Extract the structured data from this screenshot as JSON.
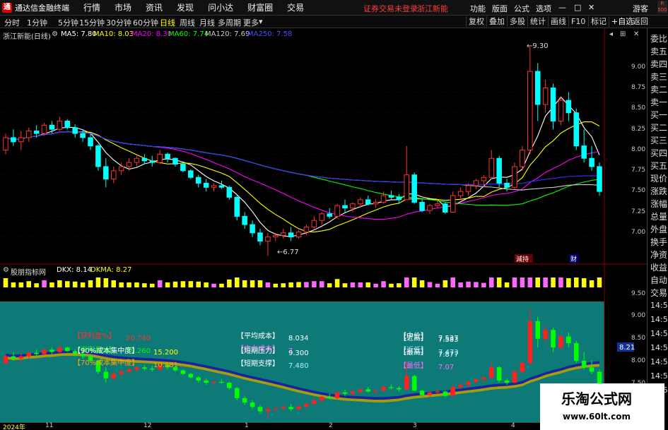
{
  "app": {
    "logo": "通",
    "title": "通达信金融终端"
  },
  "menus": [
    "行情",
    "市场",
    "资讯",
    "发现",
    "问小达",
    "财富圈",
    "交易"
  ],
  "warning": "证券交易未登录",
  "stock_name": "浙江新能",
  "right_menus": [
    "功能",
    "版面",
    "公式",
    "选项"
  ],
  "guest": "游客",
  "corner_badge": "R\n500",
  "timeframes": [
    "分时",
    "1分钟",
    "5分钟",
    "15分钟",
    "30分钟",
    "60分钟",
    "日线",
    "周线",
    "月线",
    "多周期",
    "更多"
  ],
  "active_timeframe": "日线",
  "toolbar_buttons": [
    "复权",
    "叠加",
    "多股",
    "统计",
    "画线",
    "F10",
    "标记",
    "+自选",
    "返回"
  ],
  "main_header": {
    "title": "浙江新能(日线)",
    "ma5": "MA5: 7.80",
    "ma10": "MA10: 8.03",
    "ma20": "MA20: 8.30",
    "ma60": "MA60: 7.74",
    "ma120": "MA120: 7.69",
    "ma250": "MA250: 7.58"
  },
  "annotations": {
    "high": "9.30",
    "low": "6.77",
    "event1": "減持",
    "event2": "财"
  },
  "y_ticks_main": [
    "9.00",
    "8.75",
    "8.50",
    "8.25",
    "8.00",
    "7.75",
    "7.50",
    "7.25",
    "7.00"
  ],
  "indicator_header": {
    "name": "股朋指标网",
    "dkx": "DKX: 8.14",
    "dkma": "DKMA: 8.27"
  },
  "y_ticks_ind": [
    "9.50"
  ],
  "y_ticks_teal": [
    "9.00",
    "8.50",
    "8.00",
    "7.50"
  ],
  "teal_current": "8.21",
  "teal": {
    "profit_label": "【获利盘%】",
    "profit_value": "20.740",
    "trapped_label": "【套牢盘%】",
    "trapped_value": "79.260",
    "c90_label": "【90%成本集中度】",
    "c90_value": "15.200",
    "c70_label": "【70%成本集中度】",
    "c70_value": "10.881",
    "avg_cost_label": "【平均成本】",
    "avg_cost_value": "8.034",
    "main_cost_label": "【主力成本】",
    "main_cost_value": "7",
    "press_label": "【短期压力】",
    "press_value": "9.300",
    "support_label": "【短期支撑】",
    "support_value": "7.480",
    "mid_label": "【中价】",
    "mid_value": "7.537",
    "recent_high_label": "【近高】",
    "recent_high_value": "7.583",
    "recent_low_label": "【近低】",
    "recent_low_value": "7.473",
    "top_label": "【最高】",
    "top_value": "7.877",
    "bottom_label": "【最低】",
    "bottom_value": "7.07"
  },
  "dates": [
    "2024年",
    "11",
    "12",
    "1",
    "2",
    "3",
    "4"
  ],
  "right_panel": [
    "委比",
    "卖五",
    "卖四",
    "卖三",
    "卖二",
    "卖一",
    "买一",
    "买二",
    "买三",
    "买四",
    "买五",
    "现价",
    "涨跌",
    "涨幅",
    "总量",
    "外盘",
    "换手",
    "净资",
    "收益",
    "自动",
    "交易"
  ],
  "time_ticks": [
    "14:56",
    "14:56",
    "14:56",
    "14:56",
    "14:56",
    "14:56",
    "14:56"
  ],
  "watermark": {
    "line1": "乐淘公式网",
    "line2": "www.60lt.com"
  },
  "chart_data": {
    "type": "candlestick",
    "ylim": [
      6.75,
      9.35
    ],
    "ohlc": [
      [
        8.05,
        8.25,
        8.0,
        8.2
      ],
      [
        8.2,
        8.3,
        8.1,
        8.15
      ],
      [
        8.15,
        8.28,
        8.05,
        8.2
      ],
      [
        8.2,
        8.32,
        8.15,
        8.28
      ],
      [
        8.28,
        8.35,
        8.2,
        8.25
      ],
      [
        8.25,
        8.38,
        8.22,
        8.35
      ],
      [
        8.35,
        8.4,
        8.25,
        8.3
      ],
      [
        8.3,
        8.45,
        8.28,
        8.4
      ],
      [
        8.4,
        8.42,
        8.3,
        8.32
      ],
      [
        8.32,
        8.36,
        8.2,
        8.25
      ],
      [
        8.25,
        8.3,
        8.15,
        8.2
      ],
      [
        8.2,
        8.25,
        8.05,
        8.1
      ],
      [
        8.1,
        8.12,
        7.8,
        7.85
      ],
      [
        7.85,
        7.95,
        7.6,
        7.7
      ],
      [
        7.7,
        7.85,
        7.65,
        7.8
      ],
      [
        7.8,
        7.9,
        7.75,
        7.85
      ],
      [
        7.85,
        7.95,
        7.8,
        7.9
      ],
      [
        7.9,
        7.98,
        7.85,
        7.95
      ],
      [
        7.95,
        8.0,
        7.88,
        7.92
      ],
      [
        7.92,
        7.98,
        7.85,
        7.9
      ],
      [
        7.9,
        8.05,
        7.88,
        8.0
      ],
      [
        8.0,
        8.02,
        7.9,
        7.95
      ],
      [
        7.95,
        7.96,
        7.85,
        7.88
      ],
      [
        7.88,
        7.9,
        7.78,
        7.8
      ],
      [
        7.8,
        7.82,
        7.7,
        7.72
      ],
      [
        7.72,
        7.75,
        7.6,
        7.65
      ],
      [
        7.65,
        7.7,
        7.55,
        7.6
      ],
      [
        7.6,
        7.65,
        7.55,
        7.62
      ],
      [
        7.62,
        7.68,
        7.58,
        7.6
      ],
      [
        7.6,
        7.62,
        7.45,
        7.48
      ],
      [
        7.48,
        7.5,
        7.2,
        7.25
      ],
      [
        7.25,
        7.3,
        7.1,
        7.15
      ],
      [
        7.15,
        7.2,
        7.0,
        7.05
      ],
      [
        7.05,
        7.1,
        6.9,
        6.95
      ],
      [
        6.95,
        7.05,
        6.77,
        7.0
      ],
      [
        7.0,
        7.05,
        6.95,
        7.02
      ],
      [
        7.02,
        7.1,
        6.98,
        7.05
      ],
      [
        7.05,
        7.12,
        6.95,
        7.0
      ],
      [
        7.0,
        7.08,
        6.98,
        7.06
      ],
      [
        7.06,
        7.15,
        7.02,
        7.12
      ],
      [
        7.12,
        7.25,
        7.1,
        7.2
      ],
      [
        7.2,
        7.3,
        7.15,
        7.28
      ],
      [
        7.28,
        7.35,
        7.22,
        7.25
      ],
      [
        7.25,
        7.4,
        7.22,
        7.38
      ],
      [
        7.38,
        7.45,
        7.3,
        7.35
      ],
      [
        7.35,
        7.42,
        7.3,
        7.4
      ],
      [
        7.4,
        7.48,
        7.35,
        7.45
      ],
      [
        7.45,
        7.5,
        7.38,
        7.4
      ],
      [
        7.4,
        7.46,
        7.35,
        7.42
      ],
      [
        7.42,
        7.55,
        7.4,
        7.5
      ],
      [
        7.5,
        7.56,
        7.45,
        7.48
      ],
      [
        7.48,
        7.52,
        7.4,
        7.45
      ],
      [
        7.45,
        8.1,
        7.45,
        7.75
      ],
      [
        7.75,
        7.78,
        7.4,
        7.42
      ],
      [
        7.42,
        7.45,
        7.3,
        7.32
      ],
      [
        7.32,
        7.4,
        7.28,
        7.38
      ],
      [
        7.38,
        7.45,
        7.35,
        7.4
      ],
      [
        7.4,
        7.42,
        7.28,
        7.3
      ],
      [
        7.3,
        7.55,
        7.3,
        7.5
      ],
      [
        7.5,
        7.6,
        7.45,
        7.55
      ],
      [
        7.55,
        7.65,
        7.5,
        7.62
      ],
      [
        7.62,
        7.7,
        7.58,
        7.68
      ],
      [
        7.68,
        7.75,
        7.6,
        7.72
      ],
      [
        7.72,
        8.05,
        7.7,
        7.95
      ],
      [
        7.95,
        7.98,
        7.6,
        7.65
      ],
      [
        7.65,
        7.7,
        7.55,
        7.6
      ],
      [
        7.6,
        7.9,
        7.58,
        7.85
      ],
      [
        7.85,
        8.1,
        7.8,
        8.05
      ],
      [
        8.05,
        9.3,
        8.0,
        9.0
      ],
      [
        9.0,
        9.1,
        8.4,
        8.6
      ],
      [
        8.6,
        8.9,
        8.5,
        8.8
      ],
      [
        8.8,
        8.85,
        8.3,
        8.4
      ],
      [
        8.4,
        8.7,
        8.35,
        8.65
      ],
      [
        8.65,
        8.75,
        8.4,
        8.5
      ],
      [
        8.5,
        8.55,
        8.05,
        8.1
      ],
      [
        8.1,
        8.3,
        7.9,
        7.95
      ],
      [
        7.95,
        8.1,
        7.8,
        7.85
      ],
      [
        7.85,
        7.9,
        7.5,
        7.55
      ]
    ],
    "ma_series": [
      {
        "name": "MA5",
        "color": "#ffffff"
      },
      {
        "name": "MA10",
        "color": "#ffff00"
      },
      {
        "name": "MA20",
        "color": "#ff00ff"
      },
      {
        "name": "MA60",
        "color": "#00ff00"
      },
      {
        "name": "MA120",
        "color": "#cccccc"
      },
      {
        "name": "MA250",
        "color": "#3030ff"
      }
    ]
  }
}
